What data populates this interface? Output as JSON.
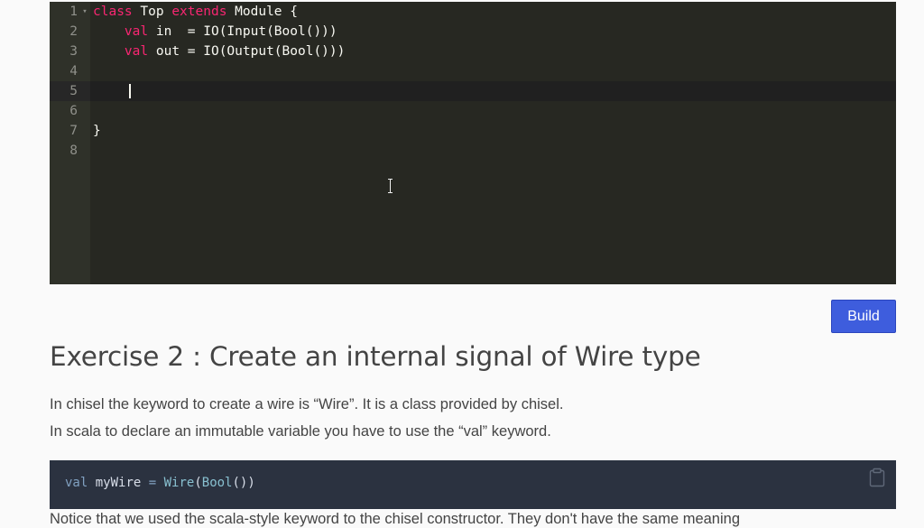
{
  "editor": {
    "lines": [
      {
        "num": "1",
        "seg": [
          {
            "t": "class",
            "k": true
          },
          {
            "t": " Top "
          },
          {
            "t": "extends",
            "k": true
          },
          {
            "t": " Module {"
          }
        ],
        "fold": true
      },
      {
        "num": "2",
        "seg": [
          {
            "t": "    "
          },
          {
            "t": "val",
            "k": true
          },
          {
            "t": " in  = IO(Input(Bool()))"
          }
        ]
      },
      {
        "num": "3",
        "seg": [
          {
            "t": "    "
          },
          {
            "t": "val",
            "k": true
          },
          {
            "t": " out = IO(Output(Bool()))"
          }
        ]
      },
      {
        "num": "4",
        "seg": []
      },
      {
        "num": "5",
        "seg": [],
        "active": true
      },
      {
        "num": "6",
        "seg": []
      },
      {
        "num": "7",
        "seg": [
          {
            "t": "}"
          }
        ]
      },
      {
        "num": "8",
        "seg": []
      }
    ]
  },
  "build_button": {
    "label": "Build"
  },
  "exercise": {
    "title": "Exercise 2 : Create an internal signal of Wire type",
    "para1": "In chisel the keyword to create a wire is “Wire”. It is a class provided by chisel.",
    "para2": "In scala to declare an immutable variable you have to use the “val” keyword."
  },
  "snippet": {
    "tokens": [
      {
        "t": "val",
        "c": "k"
      },
      {
        "t": " myWire "
      },
      {
        "t": "=",
        "c": "k"
      },
      {
        "t": " "
      },
      {
        "t": "Wire",
        "c": "f"
      },
      {
        "t": "("
      },
      {
        "t": "Bool",
        "c": "f"
      },
      {
        "t": "())"
      }
    ],
    "icon": "clipboard-icon"
  },
  "cut_text": "Notice that we used the scala-style keyword to the chisel constructor. They don't have the same meaning"
}
